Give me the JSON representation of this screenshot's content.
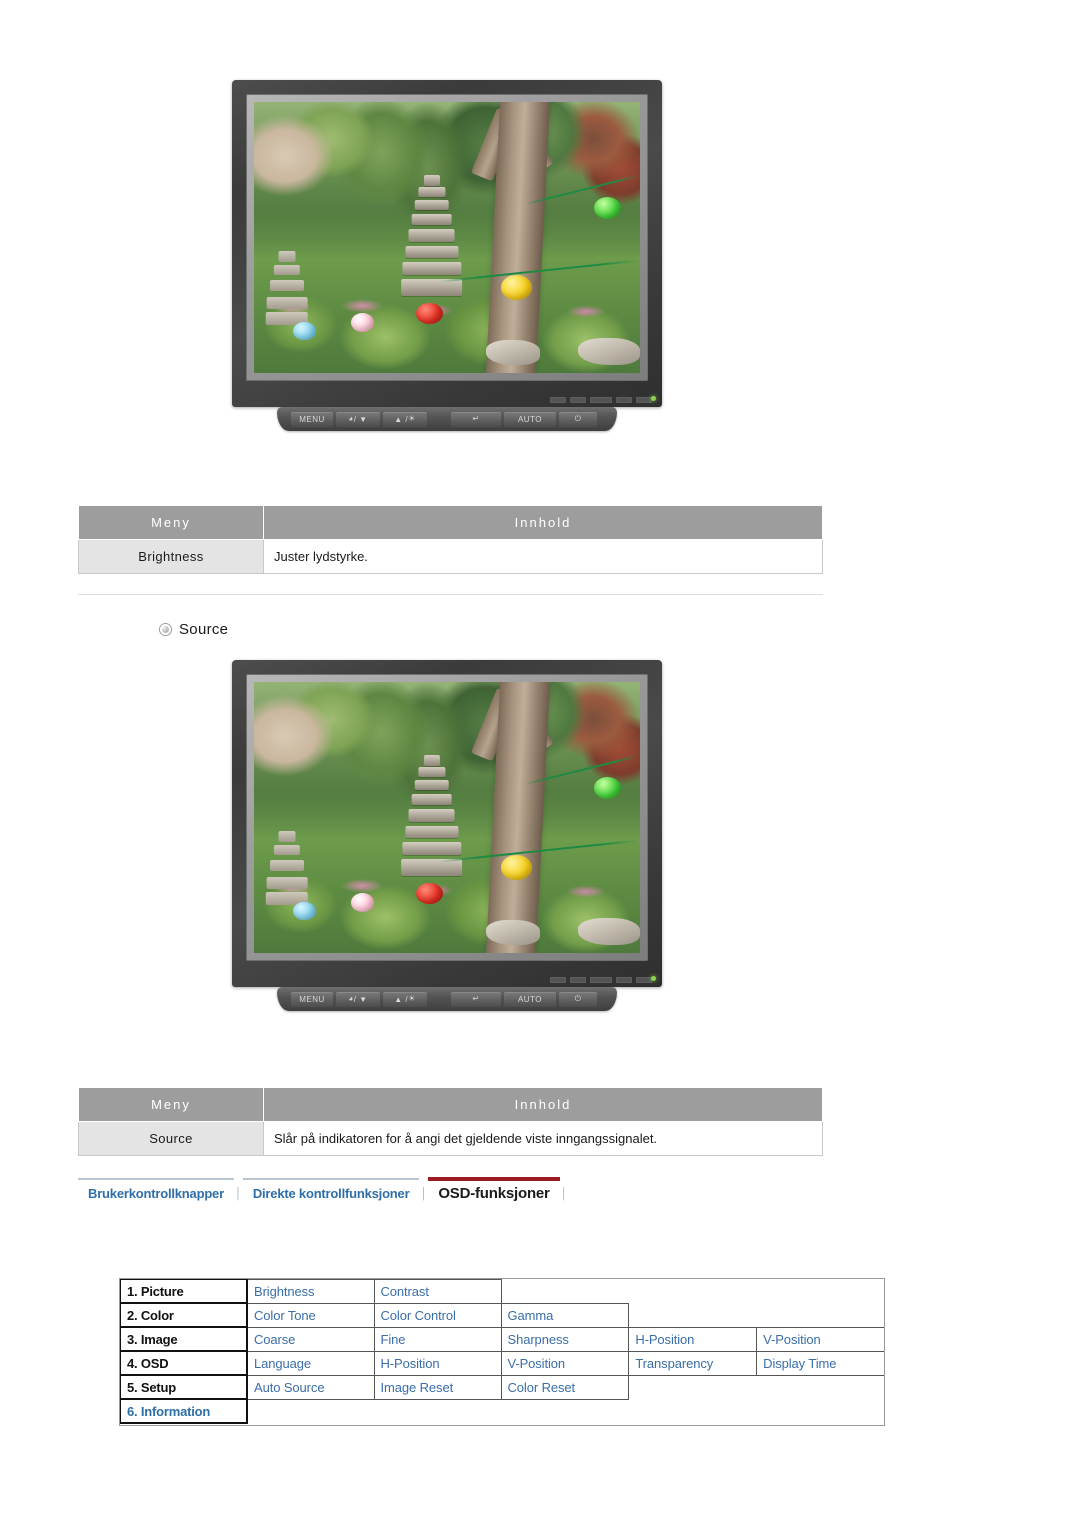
{
  "figures": [
    {
      "name": "brightness-monitor",
      "alt": "Samsung LCD monitor displaying a garden photo with stone pagoda and paper lanterns",
      "buttons": [
        {
          "id": "menu",
          "label": "MENU",
          "glyph": ""
        },
        {
          "id": "down",
          "label": "/ ▼",
          "glyph": "◕"
        },
        {
          "id": "up",
          "label": "▲ / ",
          "glyph": "☀"
        },
        {
          "id": "enter",
          "label": "",
          "glyph": "↵"
        },
        {
          "id": "auto",
          "label": "AUTO",
          "glyph": ""
        },
        {
          "id": "power",
          "label": "",
          "glyph": "⏻"
        }
      ]
    },
    {
      "name": "source-monitor",
      "alt": "Samsung LCD monitor displaying a garden photo with stone pagoda and paper lanterns",
      "buttons": [
        {
          "id": "menu",
          "label": "MENU",
          "glyph": ""
        },
        {
          "id": "down",
          "label": "/ ▼",
          "glyph": "◕"
        },
        {
          "id": "up",
          "label": "▲ / ",
          "glyph": "☀"
        },
        {
          "id": "enter",
          "label": "",
          "glyph": "↵"
        },
        {
          "id": "auto",
          "label": "AUTO",
          "glyph": ""
        },
        {
          "id": "power",
          "label": "",
          "glyph": "⏻"
        }
      ]
    }
  ],
  "table_brightness": {
    "headers": {
      "meny": "Meny",
      "innhold": "Innhold"
    },
    "row": {
      "meny": "Brightness",
      "innhold": "Juster lydstyrke."
    }
  },
  "source_heading": {
    "label": "Source"
  },
  "table_source": {
    "headers": {
      "meny": "Meny",
      "innhold": "Innhold"
    },
    "row": {
      "meny": "Source",
      "innhold": "Slår på indikatoren for å angi det gjeldende viste inngangssignalet."
    }
  },
  "navbar": {
    "tabs": [
      {
        "label": "Brukerkontrollknapper",
        "active": false
      },
      {
        "label": "Direkte kontrollfunksjoner",
        "active": false
      },
      {
        "label": "OSD-funksjoner",
        "active": true
      }
    ],
    "separator": "│",
    "active_color": "#9d1b22",
    "link_color": "#2f6fa8"
  },
  "osd_menu_map": {
    "rows": [
      {
        "category": "1. Picture",
        "items": [
          "Brightness",
          "Contrast"
        ]
      },
      {
        "category": "2. Color",
        "items": [
          "Color Tone",
          "Color Control",
          "Gamma"
        ]
      },
      {
        "category": "3. Image",
        "items": [
          "Coarse",
          "Fine",
          "Sharpness",
          "H-Position",
          "V-Position"
        ]
      },
      {
        "category": "4. OSD",
        "items": [
          "Language",
          "H-Position",
          "V-Position",
          "Transparency",
          "Display Time"
        ]
      },
      {
        "category": "5. Setup",
        "items": [
          "Auto Source",
          "Image Reset",
          "Color Reset"
        ]
      },
      {
        "category": "6. Information",
        "items": []
      }
    ]
  }
}
